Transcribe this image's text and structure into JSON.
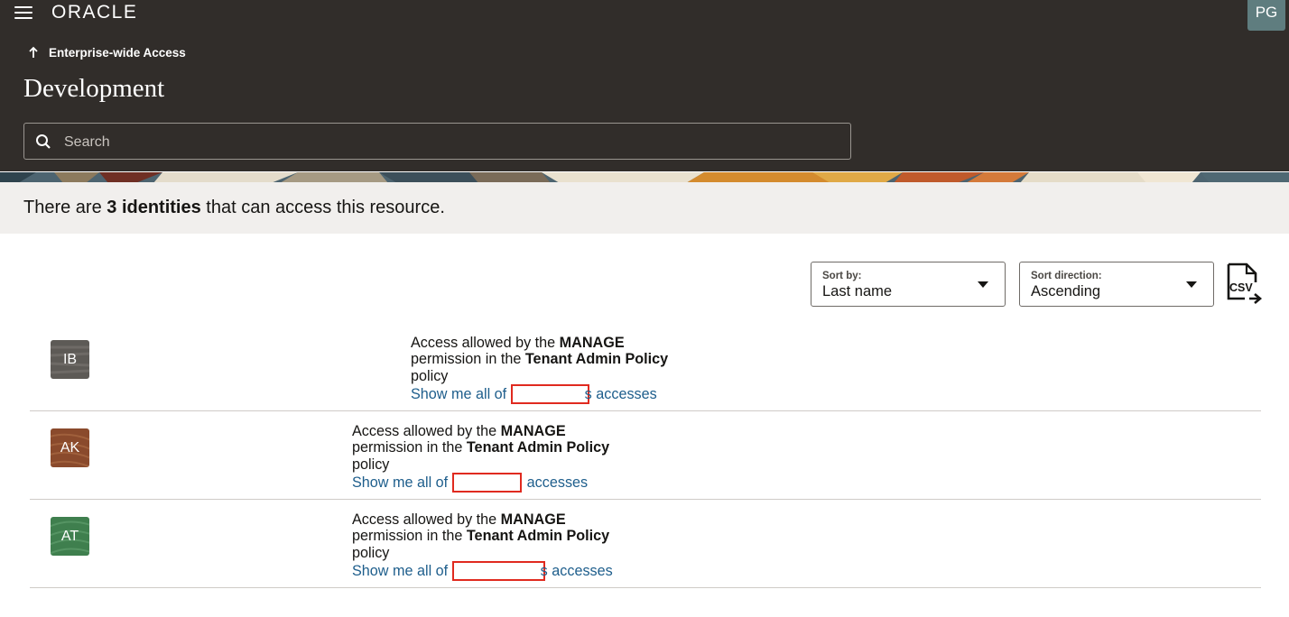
{
  "header": {
    "brand": "ORACLE",
    "user_initials": "PG",
    "breadcrumb": "Enterprise-wide Access",
    "title": "Development",
    "search_placeholder": "Search"
  },
  "summary": {
    "prefix": "There are ",
    "count_text": "3 identities",
    "suffix": " that can access this resource."
  },
  "controls": {
    "sort_by_label": "Sort by:",
    "sort_by_value": "Last name",
    "sort_direction_label": "Sort direction:",
    "sort_direction_value": "Ascending",
    "export_icon": "csv-export-icon",
    "export_text": "CSV"
  },
  "identities": [
    {
      "initials": "IB",
      "avatar_color": "#5d5a56",
      "line1": "Access allowed by the ",
      "permission": "MANAGE",
      "line2": "permission in the ",
      "policy_name": "Tenant Admin Policy",
      "line3": "policy",
      "link_prefix": "Show me all of ",
      "link_suffix": "s accesses"
    },
    {
      "initials": "AK",
      "avatar_color": "#8a4a2c",
      "line1": "Access allowed by the ",
      "permission": "MANAGE",
      "line2": "permission in the ",
      "policy_name": "Tenant Admin Policy",
      "line3": "policy",
      "link_prefix": "Show me all of ",
      "link_suffix": "accesses"
    },
    {
      "initials": "AT",
      "avatar_color": "#3f7f4e",
      "line1": "Access allowed by the ",
      "permission": "MANAGE",
      "line2": "permission in the ",
      "policy_name": "Tenant Admin Policy",
      "line3": "policy",
      "link_prefix": "Show me all of ",
      "link_suffix": "s accesses"
    }
  ],
  "colors": {
    "header_bg": "#312d2a",
    "summary_bg": "#f1efed",
    "link": "#1e5e8c",
    "redaction": "#e02a1f"
  }
}
